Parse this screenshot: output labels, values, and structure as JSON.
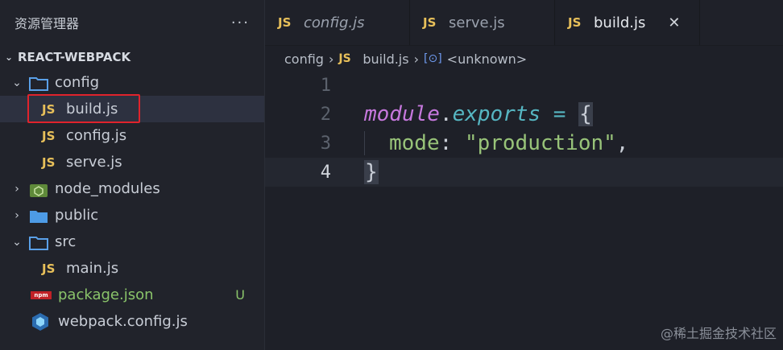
{
  "sidebar": {
    "title": "资源管理器",
    "more": "···",
    "section": "REACT-WEBPACK",
    "items": [
      {
        "label": "config",
        "type": "folder-open"
      },
      {
        "label": "build.js",
        "type": "js"
      },
      {
        "label": "config.js",
        "type": "js"
      },
      {
        "label": "serve.js",
        "type": "js"
      },
      {
        "label": "node_modules",
        "type": "node-folder"
      },
      {
        "label": "public",
        "type": "folder"
      },
      {
        "label": "src",
        "type": "folder-open"
      },
      {
        "label": "main.js",
        "type": "js"
      },
      {
        "label": "package.json",
        "type": "npm",
        "status": "U"
      },
      {
        "label": "webpack.config.js",
        "type": "webpack"
      }
    ],
    "js_badge": "JS",
    "npm_badge": "npm"
  },
  "tabs": [
    {
      "label": "config.js"
    },
    {
      "label": "serve.js"
    },
    {
      "label": "build.js",
      "active": true
    }
  ],
  "tab_close": "✕",
  "breadcrumb": {
    "folder": "config",
    "file": "build.js",
    "symbol": "<unknown>"
  },
  "code": {
    "line_numbers": [
      "1",
      "2",
      "3",
      "4"
    ],
    "module": "module",
    "dot": ".",
    "exports": "exports",
    "eq": " = ",
    "open_brace": "{",
    "prop": "mode",
    "colon": ": ",
    "str": "\"production\"",
    "comma": ",",
    "close_brace": "}"
  },
  "watermark": "@稀土掘金技术社区"
}
